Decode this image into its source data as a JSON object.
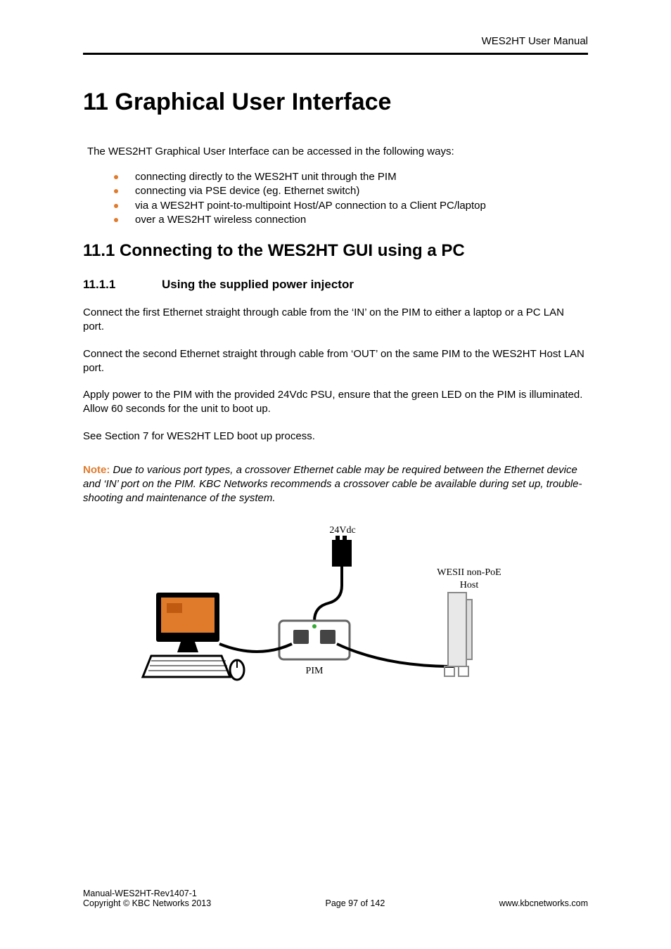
{
  "header": {
    "doc_title": "WES2HT User Manual"
  },
  "h1": "11 Graphical User Interface",
  "intro": "The WES2HT Graphical User Interface can be accessed in the following ways:",
  "bullets": [
    "connecting directly to the WES2HT unit through the PIM",
    "connecting via PSE device (eg. Ethernet switch)",
    "via a WES2HT point-to-multipoint Host/AP connection to a Client PC/laptop",
    "over a WES2HT wireless connection"
  ],
  "h2": "11.1 Connecting to the WES2HT GUI using a PC",
  "h3_num": "11.1.1",
  "h3_title": "Using the supplied power injector",
  "paras": [
    "Connect the first Ethernet straight through cable from the ‘IN’ on the PIM to either a laptop or a PC LAN port.",
    "Connect the second Ethernet straight through cable from ‘OUT’ on the same PIM to the WES2HT Host LAN port.",
    "Apply power to the PIM with the provided 24Vdc PSU, ensure that the green LED on the PIM is illuminated. Allow 60 seconds for the unit to boot up.",
    "See Section 7 for WES2HT LED boot up process."
  ],
  "note": {
    "label": "Note:",
    "body": " Due to various port types, a crossover Ethernet cable may be required between the Ethernet device and ‘IN’ port on the PIM. KBC Networks recommends a crossover cable be available during set up, trouble-shooting and maintenance of the system."
  },
  "diagram": {
    "psu_label": "24Vdc",
    "pim_label": "PIM",
    "host_label_1": "WESII non-PoE",
    "host_label_2": "Host"
  },
  "footer": {
    "manual_id": "Manual-WES2HT-Rev1407-1",
    "copyright": "Copyright © KBC Networks 2013",
    "page_label": "Page 97 of 142",
    "url": "www.kbcnetworks.com"
  }
}
